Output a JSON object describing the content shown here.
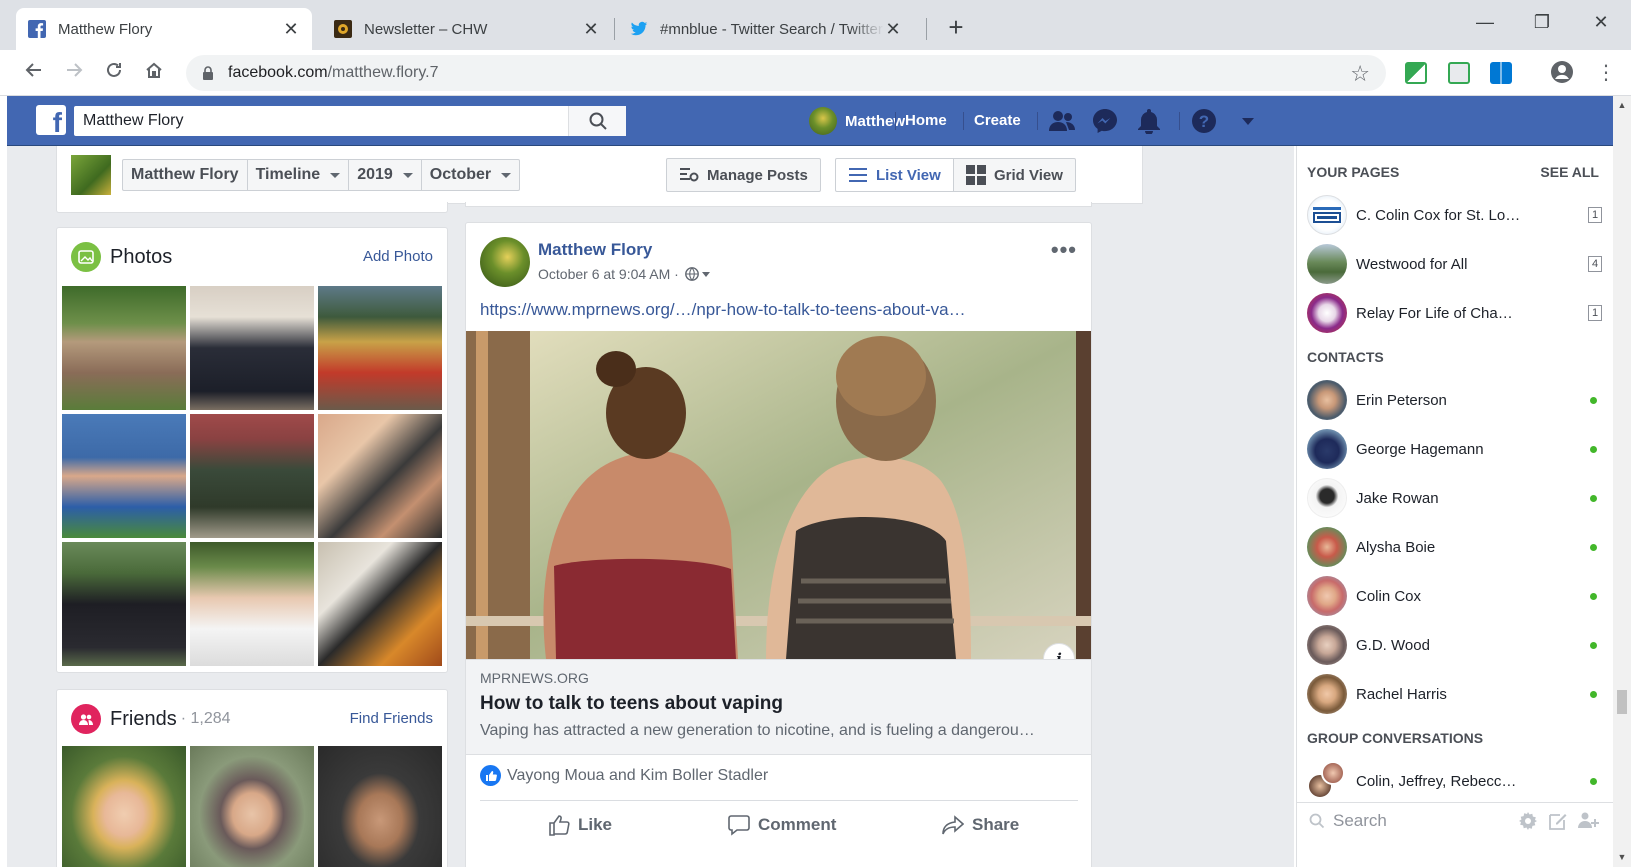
{
  "browser": {
    "tabs": [
      {
        "title": "Matthew Flory",
        "active": true,
        "favicon": "facebook-icon"
      },
      {
        "title": "Newsletter – CHW",
        "active": false,
        "favicon": "chw-icon"
      },
      {
        "title": "#mnblue - Twitter Search / Twitter",
        "active": false,
        "favicon": "twitter-icon"
      }
    ],
    "url_host": "facebook.com",
    "url_path": "/matthew.flory.7"
  },
  "fb": {
    "search_value": "Matthew Flory",
    "user_name": "Matthew",
    "nav_home": "Home",
    "nav_create": "Create",
    "help_glyph": "?"
  },
  "timeline_bar": {
    "crumbs": [
      "Matthew Flory",
      "Timeline",
      "2019",
      "October"
    ],
    "manage_posts": "Manage Posts",
    "list_view": "List View",
    "grid_view": "Grid View"
  },
  "photos": {
    "title": "Photos",
    "action": "Add Photo"
  },
  "friends": {
    "title": "Friends",
    "count": "· 1,284",
    "action": "Find Friends"
  },
  "post": {
    "author": "Matthew Flory",
    "time": "October 6 at 9:04 AM ·",
    "link": "https://www.mprnews.org/…/npr-how-to-talk-to-teens-about-va…",
    "preview": {
      "domain": "MPRNEWS.ORG",
      "title": "How to talk to teens about vaping",
      "description": "Vaping has attracted a new generation to nicotine, and is fueling a dangerou…"
    },
    "reactions": "Vayong Moua and Kim Boller Stadler",
    "actions": {
      "like": "Like",
      "comment": "Comment",
      "share": "Share"
    }
  },
  "sidebar": {
    "your_pages_label": "YOUR PAGES",
    "see_all": "SEE ALL",
    "pages": [
      {
        "name": "C. Colin Cox for St. Lo…",
        "count": "1"
      },
      {
        "name": "Westwood for All",
        "count": "4"
      },
      {
        "name": "Relay For Life of Cha…",
        "count": "1"
      }
    ],
    "contacts_label": "CONTACTS",
    "contacts": [
      {
        "name": "Erin Peterson"
      },
      {
        "name": "George Hagemann"
      },
      {
        "name": "Jake Rowan"
      },
      {
        "name": "Alysha Boie"
      },
      {
        "name": "Colin Cox"
      },
      {
        "name": "G.D. Wood"
      },
      {
        "name": "Rachel Harris"
      }
    ],
    "group_label": "GROUP CONVERSATIONS",
    "groups": [
      {
        "name": "Colin, Jeffrey, Rebecc…"
      }
    ],
    "search_placeholder": "Search"
  },
  "colors": {
    "fb_blue": "#4267b2",
    "link_blue": "#385898",
    "online_green": "#42b72a"
  }
}
